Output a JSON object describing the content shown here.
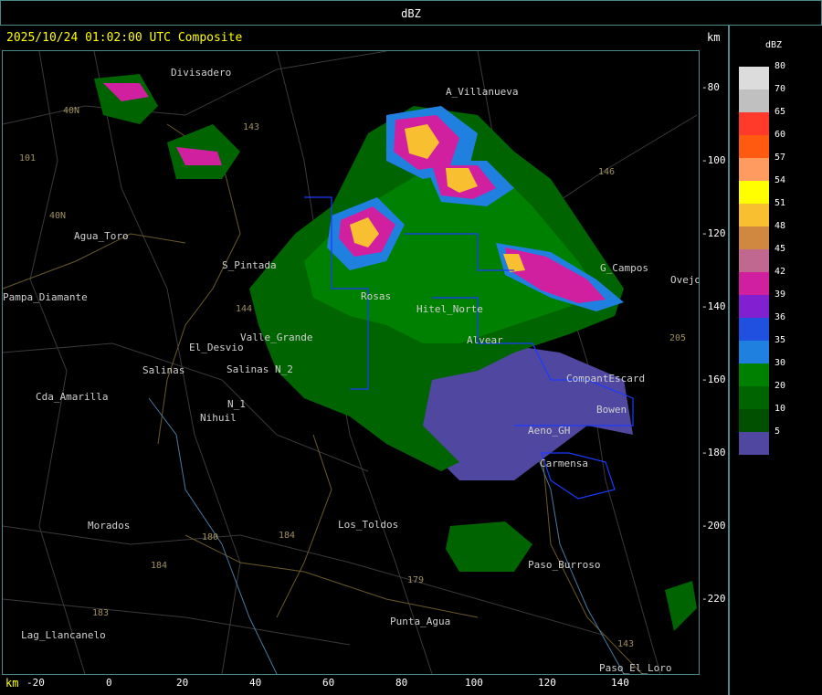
{
  "title": "dBZ",
  "header": "2025/10/24 01:02:00 UTC Composite",
  "km_label": "km",
  "y_ticks": [
    "-80",
    "-100",
    "-120",
    "-140",
    "-160",
    "-180",
    "-200",
    "-220"
  ],
  "x_ticks": [
    "-20",
    "0",
    "20",
    "40",
    "60",
    "80",
    "100",
    "120",
    "140"
  ],
  "legend": {
    "title": "dBZ",
    "levels": [
      {
        "value": "80",
        "color": "#dcdcdc"
      },
      {
        "value": "70",
        "color": "#c0c0c0"
      },
      {
        "value": "65",
        "color": "#ff3a2a"
      },
      {
        "value": "60",
        "color": "#ff5a10"
      },
      {
        "value": "57",
        "color": "#ff9a60"
      },
      {
        "value": "54",
        "color": "#ffff00"
      },
      {
        "value": "51",
        "color": "#f8c030"
      },
      {
        "value": "48",
        "color": "#d08840"
      },
      {
        "value": "45",
        "color": "#c06890"
      },
      {
        "value": "42",
        "color": "#d020a0"
      },
      {
        "value": "39",
        "color": "#8020d0"
      },
      {
        "value": "36",
        "color": "#2050e0"
      },
      {
        "value": "35",
        "color": "#2080e0"
      },
      {
        "value": "30",
        "color": "#008000"
      },
      {
        "value": "20",
        "color": "#006400"
      },
      {
        "value": "10",
        "color": "#005000"
      },
      {
        "value": "5",
        "color": "#5048a0"
      }
    ]
  },
  "places": [
    "Divisadero",
    "A_Villanueva",
    "Agua_Toro",
    "Pampa_Diamante",
    "El_Desvio",
    "Salinas",
    "Cda_Amarilla",
    "N_1",
    "Nihuil",
    "Morados",
    "Los_Toldos",
    "Lag_Llancanelo",
    "Punta_Agua",
    "Paso_Burroso",
    "Paso_El_Loro",
    "Carmensa",
    "Bowen",
    "G_Campos",
    "Ovejo",
    "S_Pintada",
    "Valle_Grande",
    "Hitel_Norte",
    "Alvear",
    "CompantEscard",
    "Aeno_GH",
    "Rosas",
    "Salinas N_2"
  ],
  "roads": [
    "40N",
    "101",
    "40N",
    "143",
    "146",
    "144",
    "180",
    "184",
    "184",
    "183",
    "179",
    "143",
    "205"
  ]
}
